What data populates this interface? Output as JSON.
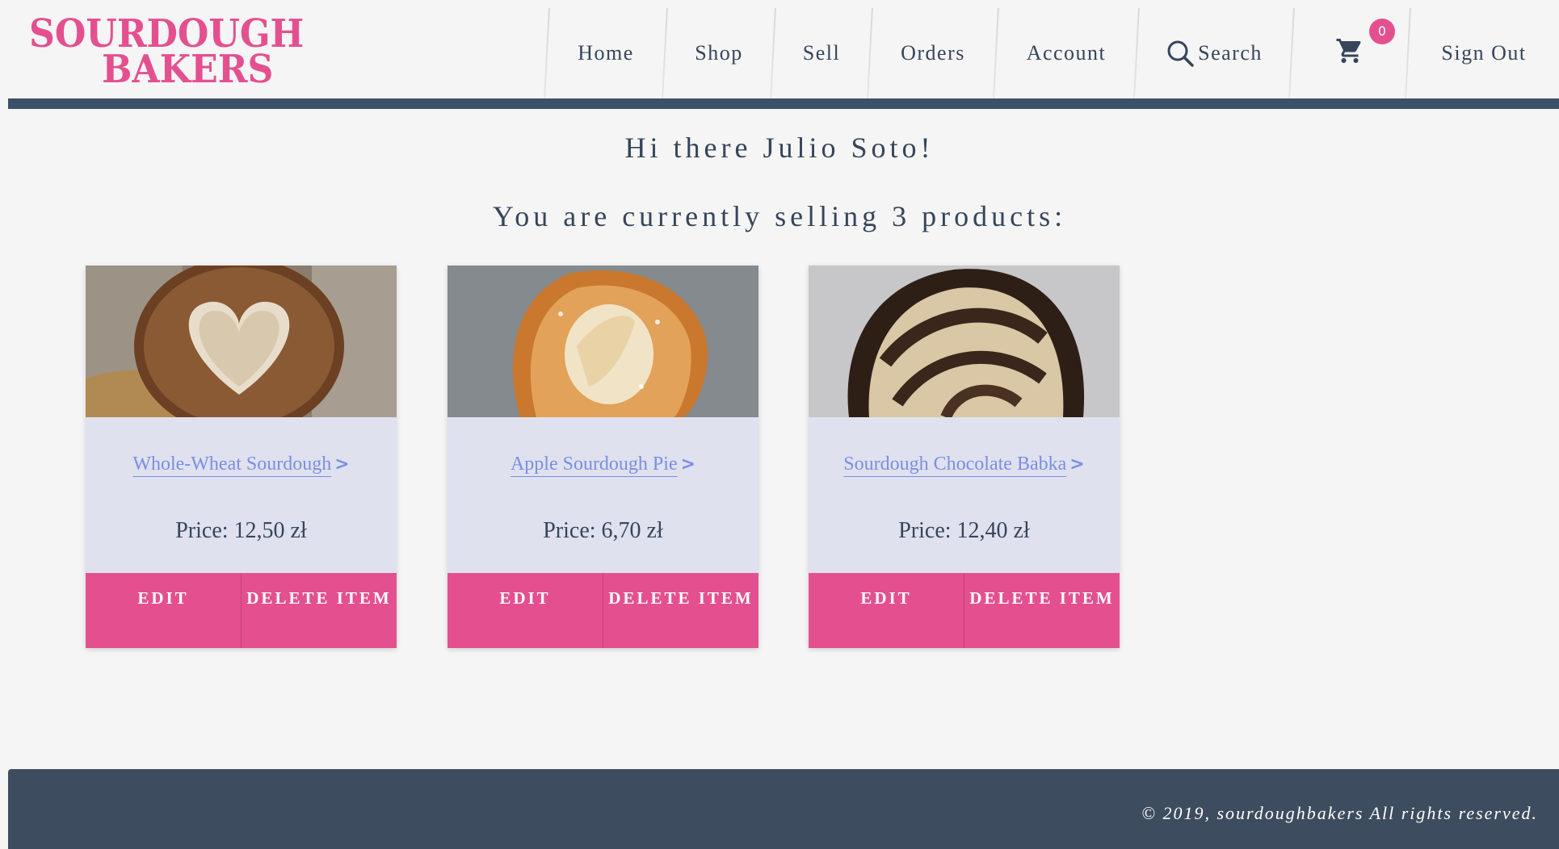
{
  "brand": {
    "line1": "SOURDOUGH",
    "line2": "BAKERS",
    "color": "#e4508f"
  },
  "nav": {
    "home": "Home",
    "shop": "Shop",
    "sell": "Sell",
    "orders": "Orders",
    "account": "Account",
    "search": "Search",
    "cart_count": "0",
    "sign_out": "Sign Out",
    "search_icon": "search-icon",
    "cart_icon": "cart-icon"
  },
  "main": {
    "greeting": "Hi there Julio Soto!",
    "count_line": "You are currently selling 3 products:"
  },
  "products": [
    {
      "name": "Whole-Wheat Sourdough",
      "price": "Price: 12,50 zł",
      "edit": "EDIT",
      "delete": "DELETE ITEM"
    },
    {
      "name": "Apple Sourdough Pie",
      "price": "Price: 6,70 zł",
      "edit": "EDIT",
      "delete": "DELETE ITEM"
    },
    {
      "name": "Sourdough Chocolate Babka",
      "price": "Price: 12,40 zł",
      "edit": "EDIT",
      "delete": "DELETE ITEM"
    }
  ],
  "footer": {
    "text": "© 2019, sourdoughbakers All rights reserved."
  },
  "colors": {
    "accent": "#e4508f",
    "navy": "#3d5069",
    "card_bg": "#dfe1ef",
    "link": "#7a8fe0"
  }
}
